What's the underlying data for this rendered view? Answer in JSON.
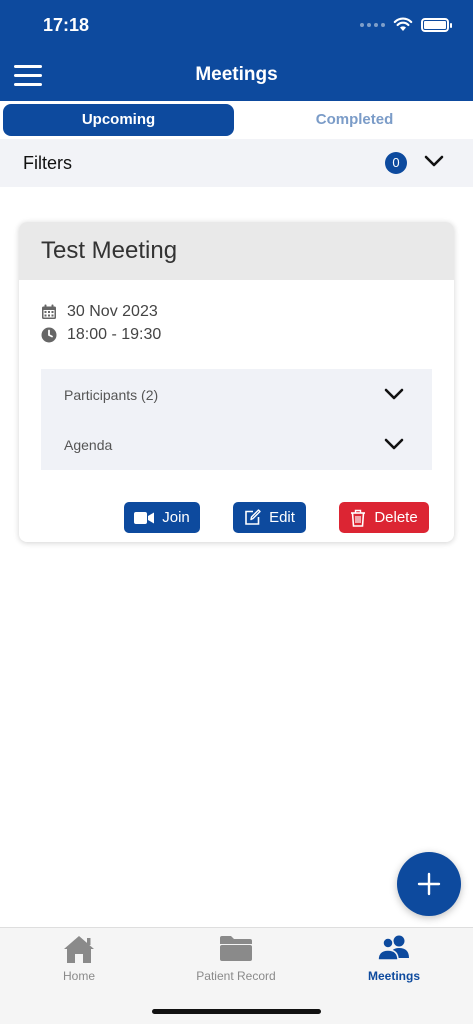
{
  "status_bar": {
    "time": "17:18"
  },
  "header": {
    "title": "Meetings"
  },
  "tabs": [
    {
      "label": "Upcoming",
      "active": true
    },
    {
      "label": "Completed",
      "active": false
    }
  ],
  "filters": {
    "label": "Filters",
    "count": "0"
  },
  "meeting_card": {
    "title": "Test Meeting",
    "date": "30 Nov 2023",
    "time": "18:00 - 19:30",
    "sections": [
      {
        "label": "Participants (2)"
      },
      {
        "label": "Agenda"
      }
    ],
    "actions": {
      "join": "Join",
      "edit": "Edit",
      "delete": "Delete"
    }
  },
  "bottom_nav": [
    {
      "label": "Home",
      "icon": "home-icon"
    },
    {
      "label": "Patient Record",
      "icon": "folder-icon"
    },
    {
      "label": "Meetings",
      "icon": "users-icon",
      "active": true
    }
  ],
  "colors": {
    "primary": "#0d4a9e",
    "danger": "#dc2533",
    "tab_inactive": "#7b9cc8"
  }
}
